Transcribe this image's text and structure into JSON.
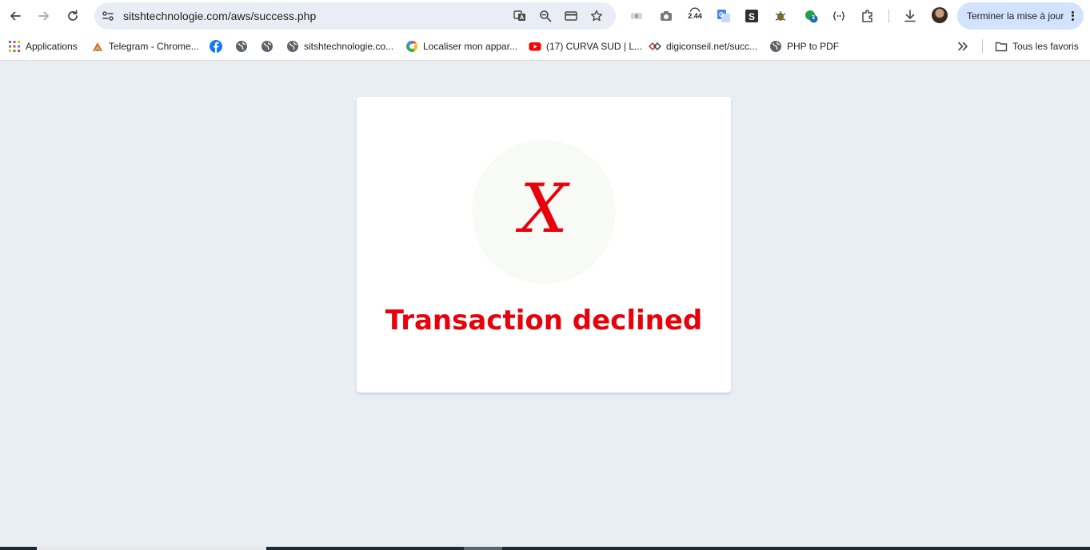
{
  "browser": {
    "url": "sitshtechnologie.com/aws/success.php",
    "extension_badge": "2.44",
    "notification_count": "3",
    "update_button_label": "Terminer la mise à jour"
  },
  "bookmarks": [
    {
      "label": "Applications",
      "icon": "apps-grid-icon"
    },
    {
      "label": "Telegram - Chrome...",
      "icon": "telegram-icon"
    },
    {
      "label": "",
      "icon": "facebook-icon"
    },
    {
      "label": "",
      "icon": "globe-icon"
    },
    {
      "label": "",
      "icon": "globe-icon"
    },
    {
      "label": "sitshtechnologie.co...",
      "icon": "globe-icon"
    },
    {
      "label": "Localiser mon appar...",
      "icon": "google-find-device-icon"
    },
    {
      "label": "(17) CURVA SUD | L...",
      "icon": "youtube-icon"
    },
    {
      "label": "digiconseil.net/succ...",
      "icon": "digiconseil-icon"
    },
    {
      "label": "PHP to PDF",
      "icon": "globe-icon"
    }
  ],
  "all_bookmarks_label": "Tous les favoris",
  "page": {
    "status_symbol": "X",
    "status_title": "Transaction declined",
    "status_color": "#e8000b"
  },
  "colors": {
    "page_background": "#e9eef3",
    "card_background": "#ffffff",
    "circle_background": "#f8faf5",
    "update_button": "#d3e3fd"
  }
}
